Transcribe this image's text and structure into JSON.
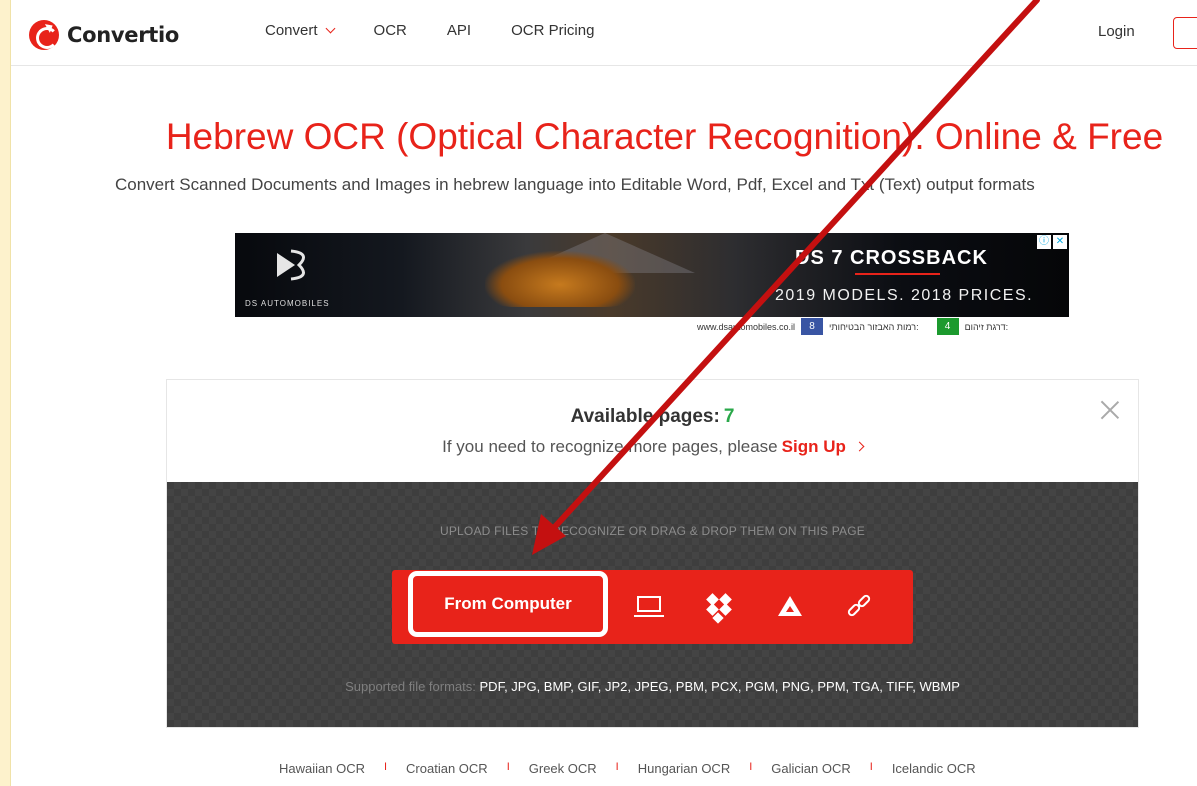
{
  "header": {
    "logo_text": "Convertio",
    "nav": [
      {
        "label": "Convert",
        "has_dropdown": true
      },
      {
        "label": "OCR",
        "has_dropdown": false
      },
      {
        "label": "API",
        "has_dropdown": false
      },
      {
        "label": "OCR Pricing",
        "has_dropdown": false
      }
    ],
    "login_label": "Login"
  },
  "hero": {
    "title": "Hebrew OCR (Optical Character Recognition). Online & Free",
    "subtitle": "Convert Scanned Documents and Images in hebrew language into Editable Word, Pdf, Excel and Txt (Text) output formats"
  },
  "ad": {
    "brand": "DS AUTOMOBILES",
    "headline": "DS 7 CROSSBACK",
    "subline": "2019 MODELS. 2018 PRICES.",
    "url": "www.dsautomobiles.co.il",
    "safety_label": "רמות האבזור הבטיחותי:",
    "safety_value": "8",
    "pollution_label": "דרגת זיהום:",
    "pollution_value": "4"
  },
  "upload": {
    "available_label": "Available pages:",
    "available_count": "7",
    "need_text": "If you need to recognize more pages, please",
    "signup_label": "Sign Up",
    "drop_label": "UPLOAD FILES TO RECOGNIZE OR DRAG & DROP THEM ON THIS PAGE",
    "from_computer_label": "From Computer",
    "sources": [
      "laptop-icon",
      "dropbox-icon",
      "google-drive-icon",
      "url-link-icon"
    ],
    "formats_label": "Supported file formats:",
    "formats_list": "PDF, JPG, BMP, GIF, JP2, JPEG, PBM, PCX, PGM, PNG, PPM, TGA, TIFF, WBMP"
  },
  "languages": [
    "Hawaiian OCR",
    "Croatian OCR",
    "Greek OCR",
    "Hungarian OCR",
    "Galician OCR",
    "Icelandic OCR"
  ],
  "colors": {
    "brand_red": "#e8231a",
    "count_green": "#2aa84a",
    "page_bg": "#fdf2cc",
    "drop_zone": "#3e3e3e"
  }
}
